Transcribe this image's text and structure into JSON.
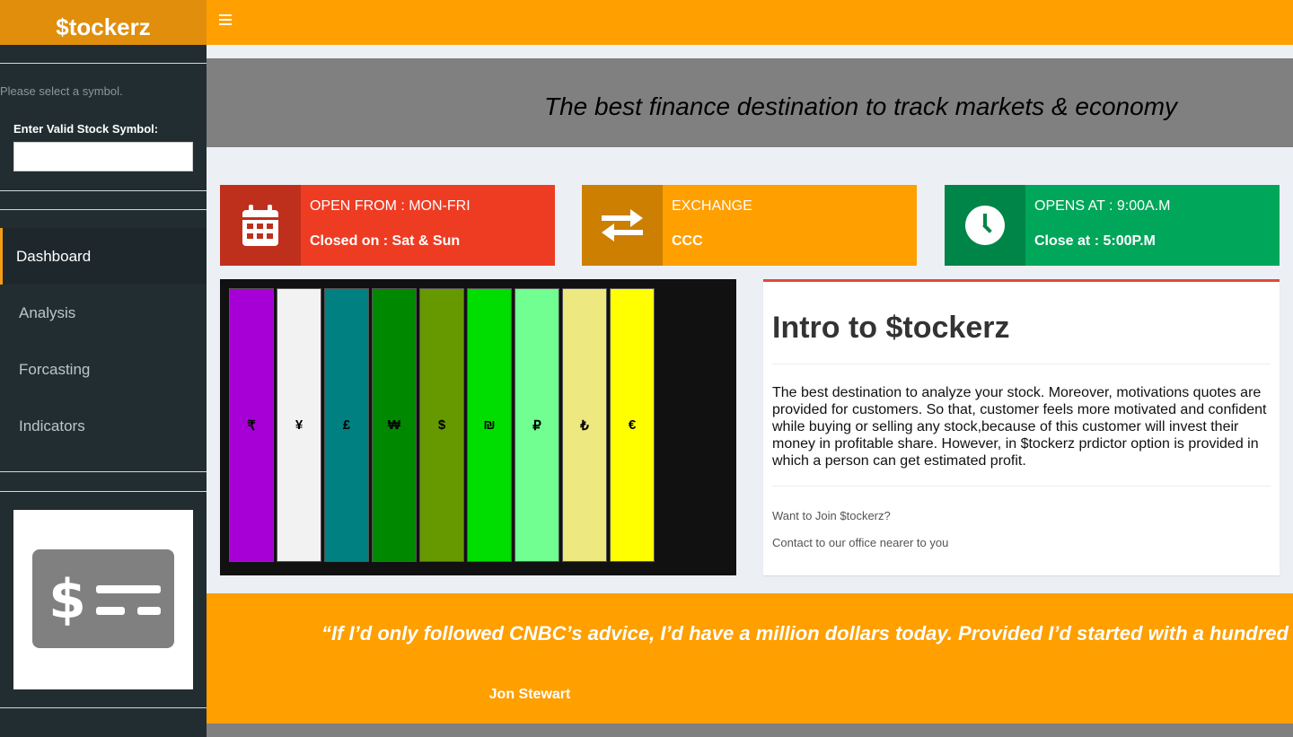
{
  "app": {
    "logo": "$tockerz"
  },
  "sidebar": {
    "help_text": "Please select a symbol.",
    "symbol_label": "Enter Valid Stock Symbol:",
    "symbol_value": "",
    "menu": [
      {
        "label": "Dashboard",
        "active": true
      },
      {
        "label": "Analysis",
        "active": false
      },
      {
        "label": "Forcasting",
        "active": false
      },
      {
        "label": "Indicators",
        "active": false
      }
    ],
    "card_icon": "money-check-dollar-icon"
  },
  "banner": {
    "text": "The best finance destination to track markets & economy"
  },
  "info_boxes": [
    {
      "line1": "OPEN FROM : MON-FRI",
      "line2": "Closed on : Sat & Sun",
      "icon": "calendar-icon",
      "color": "#ee3c23",
      "icon_bg": "#be301c"
    },
    {
      "line1": "EXCHANGE",
      "line2": "CCC",
      "icon": "exchange-icon",
      "color": "#ff9f00",
      "icon_bg": "#cc7f00"
    },
    {
      "line1": "OPENS AT : 9:00A.M",
      "line2": "Close at : 5:00P.M",
      "icon": "clock-icon",
      "color": "#00a65a",
      "icon_bg": "#008548"
    }
  ],
  "currency_bars": [
    {
      "symbol": "₹",
      "color": "#a600d6"
    },
    {
      "symbol": "¥",
      "color": "#f2f2f2"
    },
    {
      "symbol": "£",
      "color": "#008080"
    },
    {
      "symbol": "₩",
      "color": "#008800"
    },
    {
      "symbol": "$",
      "color": "#669900"
    },
    {
      "symbol": "₪",
      "color": "#00dd00"
    },
    {
      "symbol": "₽",
      "color": "#70ff90"
    },
    {
      "symbol": "₺",
      "color": "#eee880"
    },
    {
      "symbol": "€",
      "color": "#ffff00"
    }
  ],
  "intro": {
    "title": "Intro to $tockerz",
    "body": "The best destination to analyze your stock. Moreover, motivations quotes are provided for customers. So that, customer feels more motivated and confident while buying or selling any stock,because of this customer will invest their money in profitable share. However, in $tockerz prdictor option is provided in which a person can get estimated profit.",
    "footer_1": "Want to Join $tockerz?",
    "footer_2": "Contact to our office nearer to you"
  },
  "quote": {
    "text": "“If I’d only followed CNBC’s advice, I’d have a million dollars today. Provided I’d started with a hundred million",
    "author": "Jon Stewart"
  },
  "colors": {
    "accent": "#ff9f00",
    "sidebar": "#222d32",
    "banner": "#808080"
  }
}
